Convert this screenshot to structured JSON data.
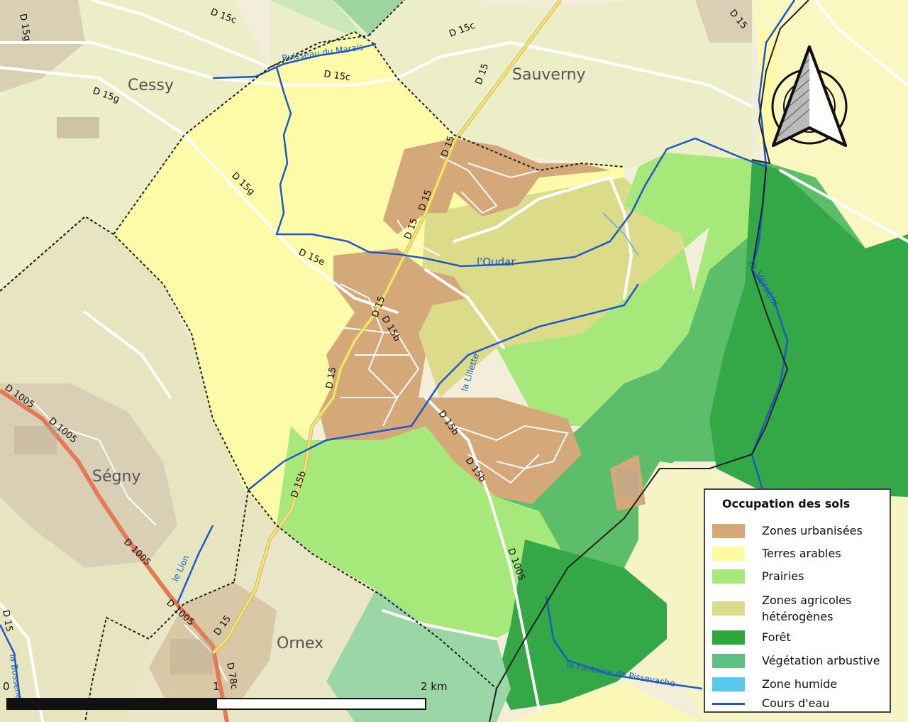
{
  "places": [
    "Cessy",
    "Sauverny",
    "Ségny",
    "Ornex"
  ],
  "roads": [
    "D 15c",
    "D 15c",
    "D 15c",
    "D 15g",
    "D 15g",
    "D 15g",
    "D 15e",
    "D 15",
    "D 15",
    "D 15",
    "D 15",
    "D 15",
    "D 15",
    "D 15",
    "D 15b",
    "D 15b",
    "D 15b",
    "D 15b",
    "D 1005",
    "D 1005",
    "D 1005",
    "D 1005",
    "D 1005",
    "D 78c",
    "D 15",
    "D 15"
  ],
  "rivers": [
    "Ruisseau du Marais",
    "l'Oudar",
    "la Versoix",
    "la Lillette",
    "le Lion",
    "la Fontaine de Pissevache",
    "la Bossena"
  ],
  "scale": {
    "zero": "0",
    "one": "1",
    "two": "2 km"
  },
  "legend": {
    "title": "Occupation des sols",
    "items": [
      {
        "label": "Zones urbanisées",
        "color": "#d4a878"
      },
      {
        "label": "Terres arables",
        "color": "#fdfba0"
      },
      {
        "label": "Prairies",
        "color": "#a6e97a"
      },
      {
        "label": "Zones agricoles hétérogènes",
        "color": "#dbdb8a"
      },
      {
        "label": "Forêt",
        "color": "#2fa83a"
      },
      {
        "label": "Végétation arbustive",
        "color": "#5fbf82"
      },
      {
        "label": "Zone humide",
        "color": "#58c8ee"
      },
      {
        "label": "Cours d'eau",
        "color": "#1f58c7"
      }
    ]
  },
  "north_arrow": "north-arrow-icon"
}
